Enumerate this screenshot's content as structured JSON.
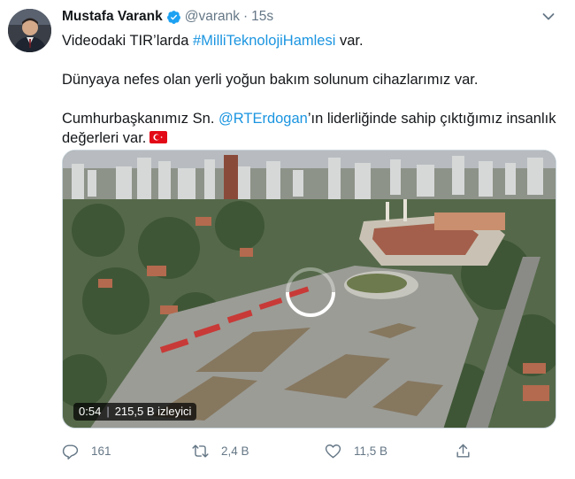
{
  "tweet": {
    "author_name": "Mustafa Varank",
    "handle": "@varank",
    "separator": "·",
    "time": "15s",
    "paragraphs": {
      "p1_before": "Videodaki TIR’larda ",
      "p1_hashtag": "#MilliTeknolojiHamlesi",
      "p1_after": " var.",
      "p2": "Dünyaya nefes olan yerli yoğun bakım solunum cihazlarımız var.",
      "p3_before": "Cumhurbaşkanımız Sn. ",
      "p3_mention": "@RTErdogan",
      "p3_after": "’ın liderliğinde sahip çıktığımız insanlık değerleri var."
    }
  },
  "media": {
    "duration": "0:54",
    "views": "215,5 B izleyici"
  },
  "actions": {
    "reply_count": "161",
    "retweet_count": "2,4 B",
    "like_count": "11,5 B"
  },
  "icons": {
    "verified": "verified-badge-icon",
    "caret": "chevron-down-icon",
    "reply": "reply-icon",
    "retweet": "retweet-icon",
    "like": "heart-icon",
    "share": "share-icon",
    "flag": "turkey-flag-icon",
    "loading": "loading-spinner-icon"
  },
  "colors": {
    "link": "#1b95e0",
    "verified": "#1da1f2",
    "muted": "#657786",
    "text": "#14171a"
  }
}
